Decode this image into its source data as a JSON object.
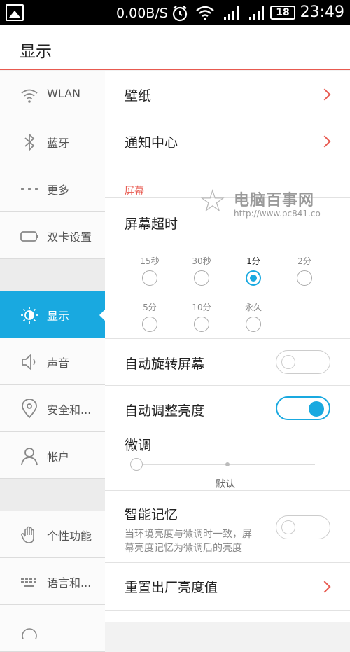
{
  "status_bar": {
    "net_speed": "0.00B/S",
    "battery": "18",
    "time": "23:49"
  },
  "header": {
    "title": "显示"
  },
  "sidebar": {
    "items": [
      {
        "label": "WLAN",
        "icon": "wifi-icon"
      },
      {
        "label": "蓝牙",
        "icon": "bluetooth-icon"
      },
      {
        "label": "更多",
        "icon": "more-dots-icon"
      },
      {
        "label": "双卡设置",
        "icon": "sim-card-icon"
      },
      {
        "label": "显示",
        "icon": "brightness-icon",
        "active": true
      },
      {
        "label": "声音",
        "icon": "speaker-icon"
      },
      {
        "label": "安全和...",
        "icon": "location-pin-icon"
      },
      {
        "label": "帐户",
        "icon": "account-icon"
      },
      {
        "label": "个性功能",
        "icon": "hand-icon"
      },
      {
        "label": "语言和...",
        "icon": "keyboard-icon"
      }
    ],
    "active_color": "#19a9e0"
  },
  "main": {
    "wallpaper": "壁纸",
    "notification_center": "通知中心",
    "screen_section": "屏幕",
    "screen_timeout": "屏幕超时",
    "timeout_options": [
      "15秒",
      "30秒",
      "1分",
      "2分",
      "5分",
      "10分",
      "永久"
    ],
    "timeout_selected": "1分",
    "auto_rotate": {
      "label": "自动旋转屏幕",
      "on": false
    },
    "auto_brightness": {
      "label": "自动调整亮度",
      "on": true
    },
    "fine_tune": "微调",
    "fine_tune_default": "默认",
    "smart_memory": {
      "label": "智能记忆",
      "desc_line1": "当环境亮度与微调时一致，屏",
      "desc_line2": "幕亮度记忆为微调后的亮度",
      "on": false
    },
    "reset_brightness": "重置出厂亮度值"
  },
  "watermark": {
    "text": "电脑百事网",
    "url": "http://www.pc841.co"
  },
  "colors": {
    "accent": "#19a9e0",
    "red": "#e85a50"
  }
}
